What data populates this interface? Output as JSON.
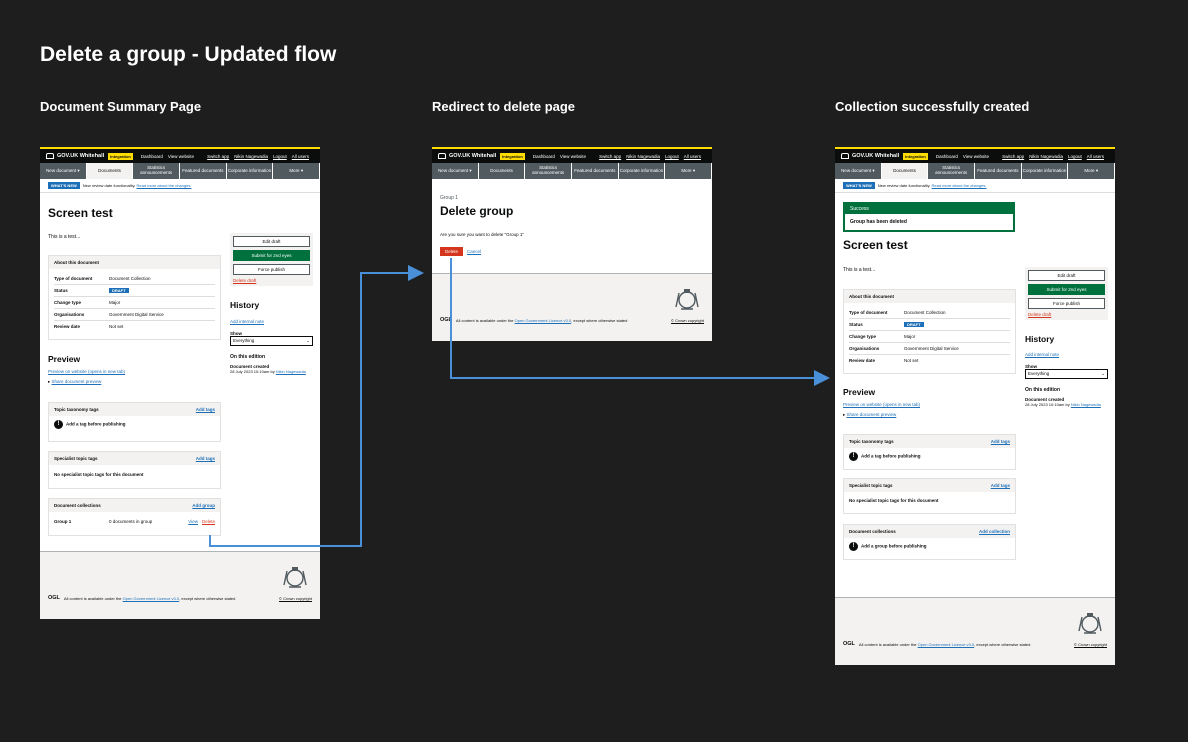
{
  "board": {
    "title": "Delete a group - Updated flow",
    "frames": [
      "Document Summary Page",
      "Redirect to delete page",
      "Collection successfully created"
    ]
  },
  "header": {
    "brand": "GOV.UK Whitehall",
    "env": "Integration",
    "links": [
      "Dashboard",
      "View website"
    ],
    "right_links": [
      "Switch app",
      "Nikin Nagewadia",
      "Logout",
      "All users"
    ]
  },
  "nav": [
    "New document ▾",
    "Documents",
    "Statistics announcements",
    "Featured documents",
    "Corporate information",
    "More ▾"
  ],
  "whats_new": {
    "tag": "WHAT'S NEW",
    "text": "New review date functionality.",
    "link": "Read more about the changes."
  },
  "doc": {
    "title": "Screen test",
    "summary": "This is a test...",
    "about_heading": "About this document",
    "rows": [
      {
        "k": "Type of document",
        "v": "Document Collection"
      },
      {
        "k": "Status",
        "v": "DRAFT"
      },
      {
        "k": "Change type",
        "v": "Major"
      },
      {
        "k": "Organisations",
        "v": "Government Digital Service"
      },
      {
        "k": "Review date",
        "v": "Not set"
      }
    ],
    "actions": {
      "edit": "Edit draft",
      "submit": "Submit for 2nd eyes",
      "force": "Force publish",
      "delete": "Delete draft"
    },
    "history": {
      "title": "History",
      "add_note": "Add internal note",
      "show_label": "Show",
      "show_value": "Everything",
      "on_this_edition": "On this edition",
      "event": "Document created",
      "event_time": "28 July 2023 10:10am by",
      "event_user": "Nikin Nagewadia"
    },
    "preview": {
      "title": "Preview",
      "link": "Preview on website (opens in new tab)",
      "share": "Share document preview"
    },
    "topic": {
      "title": "Topic taxonomy tags",
      "action": "Add tags",
      "warning": "Add a tag before publishing"
    },
    "specialist": {
      "title": "Specialist topic tags",
      "action": "Add tags",
      "empty": "No specialist topic tags for this document"
    },
    "collections": {
      "title": "Document collections",
      "action": "Add group",
      "group_name": "Group 1",
      "group_count": "0 documents in group",
      "view": "View",
      "delete": "Delete"
    },
    "collections_after": {
      "title": "Document collections",
      "action": "Add collection",
      "warning": "Add a group before publishing"
    }
  },
  "delete_page": {
    "caption": "Group 1",
    "title": "Delete group",
    "question": "Are you sure you want to delete \"Group 1\"",
    "delete": "Delete",
    "cancel": "Cancel"
  },
  "success": {
    "title": "Success",
    "message": "Group has been deleted"
  },
  "footer": {
    "ogl": "OGL",
    "text_a": "All content is available under the",
    "licence": "Open Government Licence v3.0",
    "text_b": ", except where otherwise stated",
    "copyright": "© Crown copyright"
  },
  "colors": {
    "background": "#1e1e1e",
    "arrow": "#4a90d9",
    "accent_yellow": "#ffdd00",
    "green": "#00703c",
    "red": "#d4351c",
    "blue": "#1d70b8"
  }
}
